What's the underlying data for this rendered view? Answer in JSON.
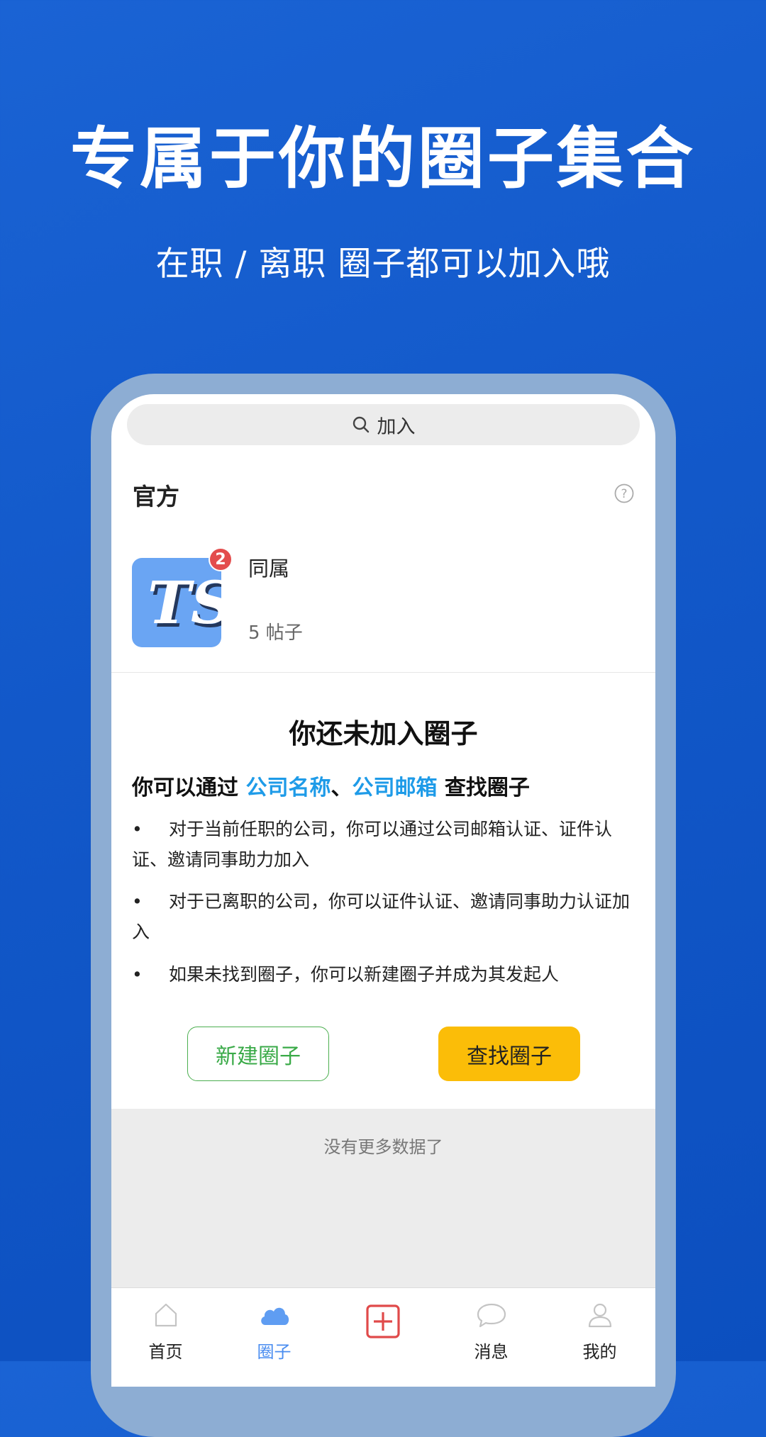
{
  "promo": {
    "headline": "专属于你的圈子集合",
    "subheadline": "在职 / 离职 圈子都可以加入哦"
  },
  "search": {
    "placeholder": "加入"
  },
  "official_section": {
    "title": "官方"
  },
  "official_circle": {
    "name": "同属",
    "posts": "5 帖子",
    "badge_count": "2",
    "logo_text": "TS"
  },
  "empty_state": {
    "title": "你还未加入圈子",
    "find_prefix": "你可以通过 ",
    "find_option_1": "公司名称",
    "find_separator": "、",
    "find_option_2": "公司邮箱",
    "find_suffix": " 查找圈子",
    "bullet_1": "对于当前任职的公司，你可以通过公司邮箱认证、证件认证、邀请同事助力加入",
    "bullet_2": "对于已离职的公司，你可以证件认证、邀请同事助力认证加入",
    "bullet_3": "如果未找到圈子，你可以新建圈子并成为其发起人",
    "bullet_symbol": "•"
  },
  "buttons": {
    "new_circle": "新建圈子",
    "find_circle": "查找圈子"
  },
  "list_footer": {
    "no_more": "没有更多数据了"
  },
  "tabbar": {
    "home": "首页",
    "circles": "圈子",
    "messages": "消息",
    "mine": "我的",
    "active_tab": "circles"
  },
  "colors": {
    "background": "#1258c9",
    "accent_link": "#1e9be8",
    "find_button": "#fbbd08",
    "new_button_border": "#4caf50",
    "badge": "#e34d4d",
    "active_tab": "#4a8df0",
    "publish_icon": "#e04a4a"
  },
  "icons": [
    "search-icon",
    "help-icon",
    "home-icon",
    "circles-cloud-icon",
    "publish-plus-icon",
    "message-bubble-icon",
    "profile-icon"
  ]
}
